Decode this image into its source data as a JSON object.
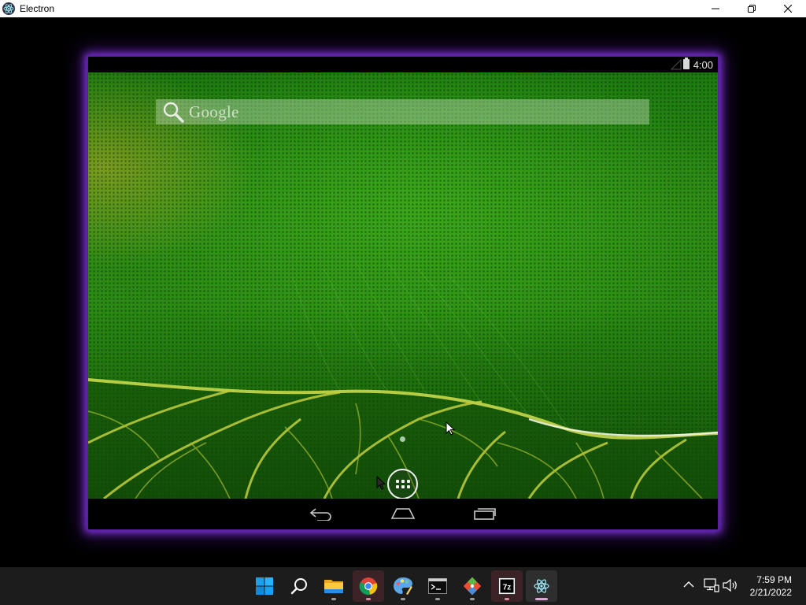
{
  "window": {
    "title": "Electron",
    "controls": [
      "minimize",
      "restore",
      "close"
    ]
  },
  "android": {
    "status_bar": {
      "time": "4:00",
      "icons": [
        "signal-icon",
        "battery-icon"
      ]
    },
    "search_widget": {
      "label": "Google"
    },
    "home": {
      "page_indicator_count": 1,
      "all_apps_icon": "all-apps-icon"
    },
    "nav_bar": {
      "buttons": [
        "back",
        "home",
        "recents"
      ]
    }
  },
  "taskbar": {
    "apps": [
      {
        "name": "Start",
        "icon": "windows-start-icon"
      },
      {
        "name": "Search",
        "icon": "search-icon"
      },
      {
        "name": "File Explorer",
        "icon": "folder-icon"
      },
      {
        "name": "Google Chrome",
        "icon": "chrome-icon"
      },
      {
        "name": "Paint",
        "icon": "paint-palette-icon"
      },
      {
        "name": "Terminal",
        "icon": "terminal-icon"
      },
      {
        "name": "Git",
        "icon": "git-icon"
      },
      {
        "name": "7-Zip",
        "icon": "7zip-icon",
        "label": "7z"
      },
      {
        "name": "Electron",
        "icon": "electron-icon"
      }
    ],
    "tray": {
      "icons": [
        "chevron-up-icon",
        "network-icon",
        "volume-icon"
      ],
      "time": "7:59 PM",
      "date": "2/21/2022"
    }
  },
  "colors": {
    "accent_glow": "#9a3cff",
    "wallpaper_green": "#2b8a14",
    "taskbar_bg": "#1c1c1c"
  }
}
